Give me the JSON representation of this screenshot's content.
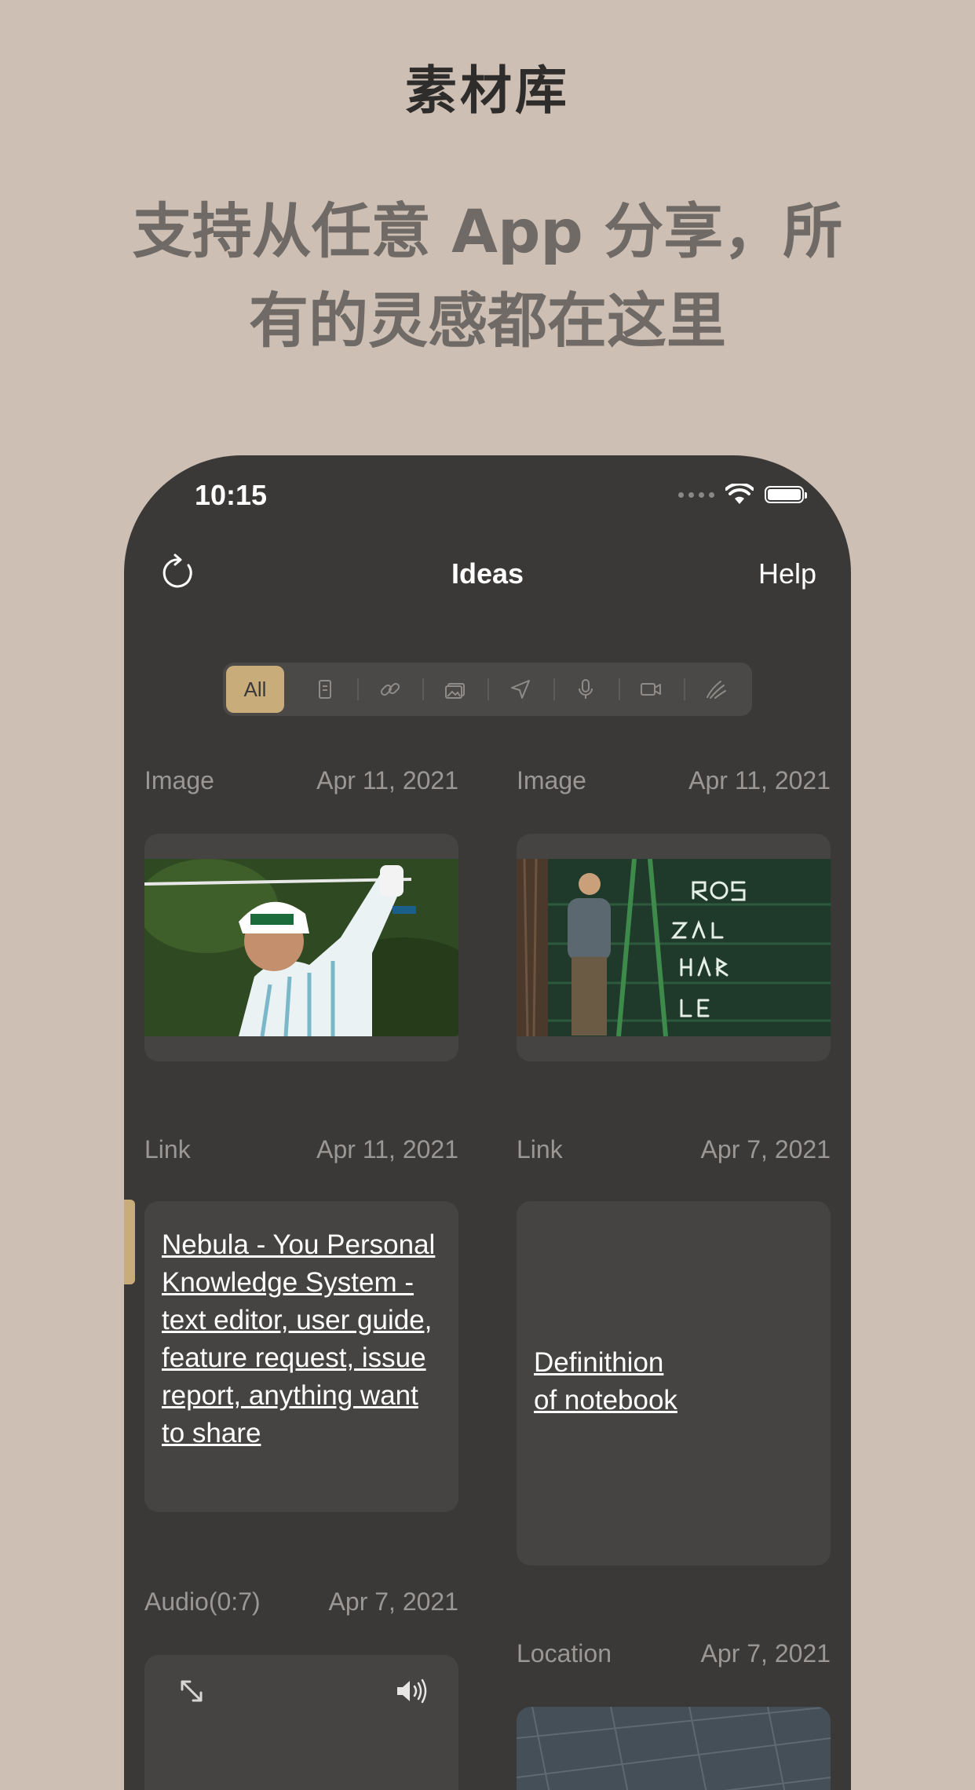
{
  "hero": {
    "title": "素材库",
    "subtitle_line1": "支持从任意 App 分享，所",
    "subtitle_line2": "有的灵感都在这里"
  },
  "status": {
    "time": "10:15"
  },
  "nav": {
    "title": "Ideas",
    "help_label": "Help"
  },
  "filter": {
    "active_label": "All",
    "icons": [
      "note-icon",
      "link-icon",
      "image-icon",
      "location-icon",
      "mic-icon",
      "video-icon",
      "sketch-icon"
    ]
  },
  "cards": [
    {
      "type": "Image",
      "date": "Apr 11, 2021"
    },
    {
      "type": "Image",
      "date": "Apr 11, 2021"
    },
    {
      "type": "Link",
      "date": "Apr 11, 2021",
      "text": "Nebula - You Personal Knowledge System - text editor, user guide, feature request, issue report, anything want to share"
    },
    {
      "type": "Link",
      "date": "Apr 7, 2021",
      "text_line1": "Definithion",
      "text_line2": "of notebook"
    },
    {
      "type": "Audio(0:7)",
      "date": "Apr 7, 2021"
    },
    {
      "type": "Location",
      "date": "Apr 7, 2021"
    }
  ],
  "colors": {
    "background": "#cdbfb3",
    "phone": "#3a3938",
    "card": "#454443",
    "accent": "#c8ac7a"
  }
}
